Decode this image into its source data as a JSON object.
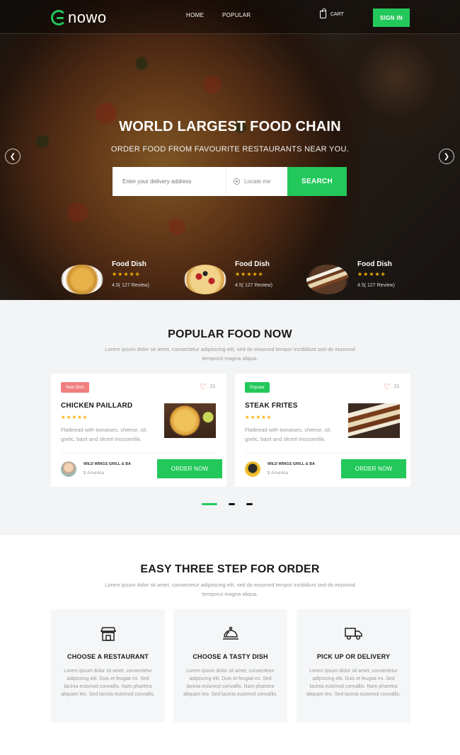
{
  "nav": {
    "logo_text": "nowo",
    "links": [
      "HOME",
      "POPULAR"
    ],
    "cart_label": "CART",
    "signin_label": "SIGN IN"
  },
  "hero": {
    "title": "WORLD LARGEST FOOD CHAIN",
    "subtitle": "ORDER FOOD FROM FAVOURITE RESTAURANTS NEAR YOU.",
    "address_placeholder": "Enter your delivery address",
    "locate_label": "Locate me",
    "search_label": "SEARCH",
    "dishes": [
      {
        "name": "Food Dish",
        "rating": 4.5,
        "stars": "★★★★✬",
        "review": "4.5( 127 Review)"
      },
      {
        "name": "Food Dish",
        "rating": 4.5,
        "stars": "★★★★✬",
        "review": "4.5( 127 Review)"
      },
      {
        "name": "Food Dish",
        "rating": 4.5,
        "stars": "★★★★✬",
        "review": "4.5( 127 Review)"
      }
    ]
  },
  "popular": {
    "title": "POPULAR FOOD NOW",
    "description": "Lorem ipsum dolor sit amet, consectetur adipisicing elit, sed do eiusmod tempor incididunt sed do eiusmod temporut magna aliqua.",
    "cards": [
      {
        "tag": "New Dish",
        "tag_color": "#f07f7f",
        "likes": "21",
        "title": "CHICKEN PAILLARD",
        "rating": 4.5,
        "stars": "★★★★✬",
        "description": "Flatbread with tomatoes, cheese, oil, garlic, basil and sliced mozzarella.",
        "restaurant": "WILD WINGS GRILL & BA",
        "location": "America",
        "order_label": "ORDER NOW"
      },
      {
        "tag": "Popular",
        "tag_color": "#23c85a",
        "likes": "21",
        "title": "STEAK FRITES",
        "rating": 4.5,
        "stars": "★★★★✬",
        "description": "Flatbread with tomatoes, cheese, oil, garlic, basil and sliced mozzarella.",
        "restaurant": "WILD WINGS GRILL & BA",
        "location": "America",
        "order_label": "ORDER NOW"
      }
    ]
  },
  "steps": {
    "title": "EASY THREE STEP FOR ORDER",
    "description": "Lorem ipsum dolor sit amet, consectetur adipisicing elit, sed do eiusmod tempor incididunt sed do eiusmod temporut magna aliqua.",
    "items": [
      {
        "icon": "store-icon",
        "title": "CHOOSE A RESTAURANT",
        "text": "Lorem ipsum dolor sit amet, consectetur adipiscing elit. Duis et feugiat mi. Sed lacinia euismod convallis. Nam pharetra aliquam leo. Sed lacinia euismod convallis."
      },
      {
        "icon": "dish-cloche-icon",
        "title": "CHOOSE A TASTY DISH",
        "text": "Lorem ipsum dolor sit amet, consectetur adipiscing elit. Duis et feugiat mi. Sed lacinia euismod convallis. Nam pharetra aliquam leo. Sed lacinia euismod convallis."
      },
      {
        "icon": "delivery-truck-icon",
        "title": "PICK UP OR DELIVERY",
        "text": "Lorem ipsum dolor sit amet, consectetur adipiscing elit. Duis et feugiat mi. Sed lacinia euismod convallis. Nam pharetra aliquam leo. Sed lacinia euismod convallis."
      }
    ]
  },
  "colors": {
    "accent": "#23c85a",
    "star": "#f5b301"
  }
}
